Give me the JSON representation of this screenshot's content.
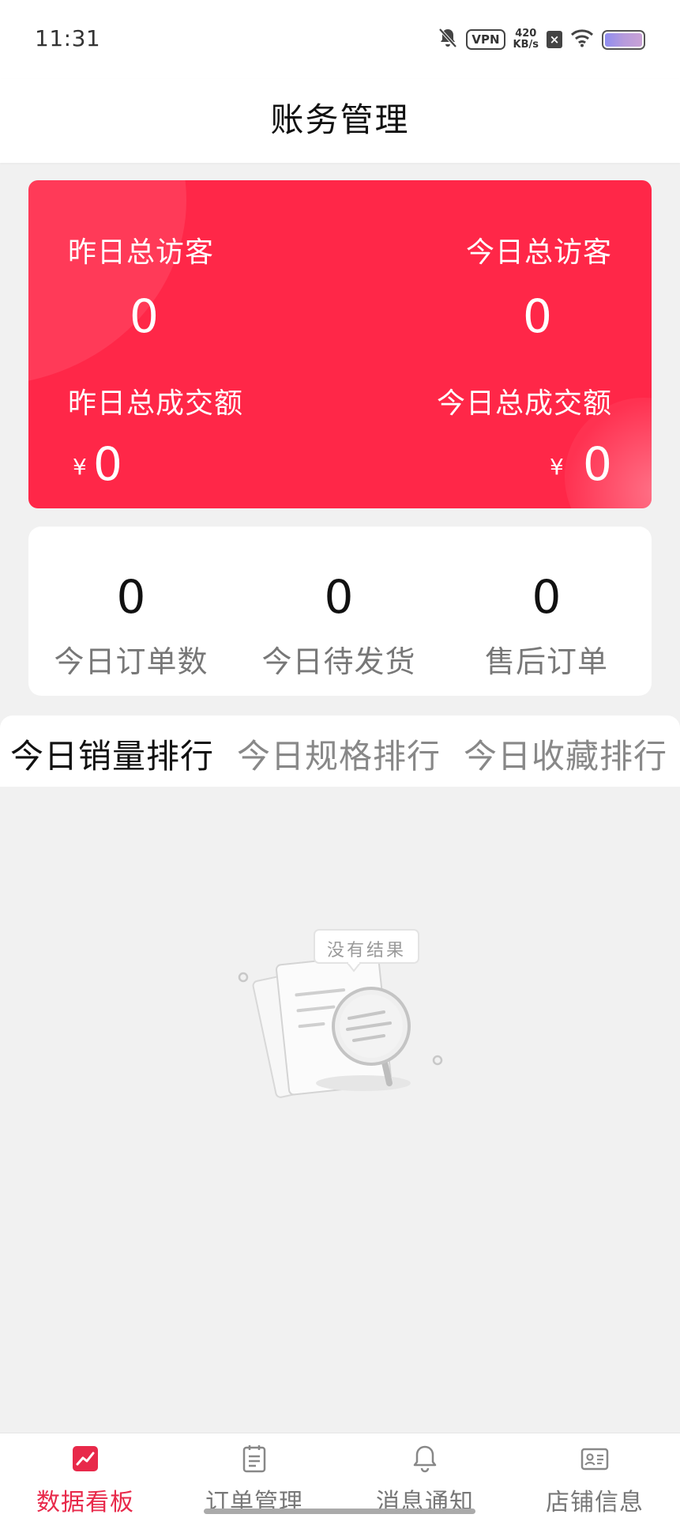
{
  "status_bar": {
    "time": "11:31",
    "vpn": "VPN",
    "speed_value": "420",
    "speed_unit": "KB/s",
    "x_badge": "×",
    "icons": [
      "bell-off-icon",
      "wifi-icon",
      "battery-icon"
    ]
  },
  "header": {
    "title": "账务管理"
  },
  "summary": {
    "yesterday_visitors_label": "昨日总访客",
    "yesterday_visitors_value": "0",
    "today_visitors_label": "今日总访客",
    "today_visitors_value": "0",
    "yesterday_sales_label": "昨日总成交额",
    "yesterday_sales_value": "0",
    "today_sales_label": "今日总成交额",
    "today_sales_value": "0",
    "currency": "¥",
    "card_color": "#ff2748"
  },
  "orders": {
    "items": [
      {
        "value": "0",
        "label": "今日订单数"
      },
      {
        "value": "0",
        "label": "今日待发货"
      },
      {
        "value": "0",
        "label": "售后订单"
      }
    ]
  },
  "tabs": {
    "items": [
      {
        "label": "今日销量排行",
        "active": true
      },
      {
        "label": "今日规格排行",
        "active": false
      },
      {
        "label": "今日收藏排行",
        "active": false
      }
    ]
  },
  "empty_state": {
    "text": "没有结果",
    "icon": "magnifier-document-icon"
  },
  "bottom_nav": {
    "accent": "#e8294a",
    "items": [
      {
        "label": "数据看板",
        "icon": "chart-icon",
        "active": true
      },
      {
        "label": "订单管理",
        "icon": "clipboard-icon",
        "active": false
      },
      {
        "label": "消息通知",
        "icon": "bell-icon",
        "active": false
      },
      {
        "label": "店铺信息",
        "icon": "id-card-icon",
        "active": false
      }
    ]
  }
}
